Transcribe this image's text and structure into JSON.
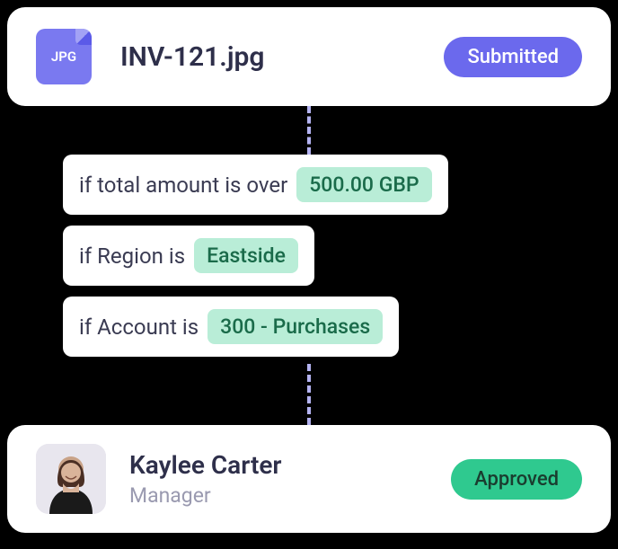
{
  "file": {
    "icon_label": "JPG",
    "name": "INV-121.jpg",
    "status": "Submitted"
  },
  "rules": [
    {
      "prefix": "if total amount is over",
      "value": "500.00 GBP"
    },
    {
      "prefix": "if Region is",
      "value": "Eastside"
    },
    {
      "prefix": "if Account is",
      "value": "300 - Purchases"
    }
  ],
  "approver": {
    "name": "Kaylee Carter",
    "role": "Manager",
    "status": "Approved"
  }
}
